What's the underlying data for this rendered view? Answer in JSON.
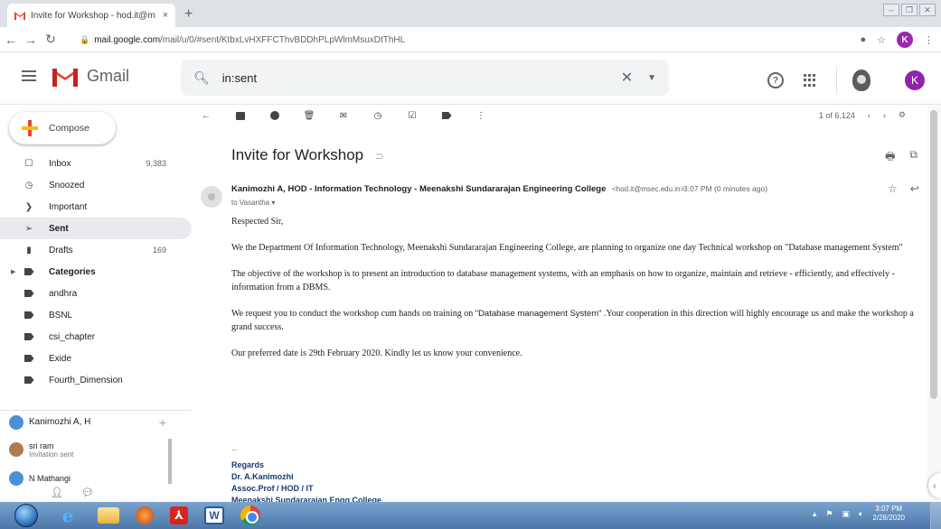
{
  "browser": {
    "tab_title": "Invite for Workshop - hod.it@m",
    "tab_close": "×",
    "new_tab": "+",
    "url_domain": "mail.google.com",
    "url_path": "/mail/u/0/#sent/KtbxLvHXFFCThvBDDhPLpWlmMsuxDtThHL"
  },
  "gmail": {
    "app_name": "Gmail",
    "search_value": "in:sent",
    "profile_initial": "K",
    "help": "?"
  },
  "sidebar": {
    "compose": "Compose",
    "items": [
      {
        "label": "Inbox",
        "count": "9,383"
      },
      {
        "label": "Snoozed",
        "count": ""
      },
      {
        "label": "Important",
        "count": ""
      },
      {
        "label": "Sent",
        "count": ""
      },
      {
        "label": "Drafts",
        "count": "169"
      },
      {
        "label": "Categories",
        "count": ""
      },
      {
        "label": "andhra",
        "count": ""
      },
      {
        "label": "BSNL",
        "count": ""
      },
      {
        "label": "csi_chapter",
        "count": ""
      },
      {
        "label": "Exide",
        "count": ""
      },
      {
        "label": "Fourth_Dimension",
        "count": ""
      }
    ],
    "chat_self": "Kanimozhi A, H",
    "chats": [
      {
        "name": "sri ram",
        "status": "Invitation sent"
      },
      {
        "name": "N Mathangi",
        "status": ""
      }
    ]
  },
  "toolbar": {
    "pager": "1 of 6,124"
  },
  "message": {
    "subject": "Invite for Workshop",
    "sender_name": "Kanimozhi A, HOD - Information Technology - Meenakshi Sundararajan Engineering College",
    "sender_email": "<hod.it@msec.edu.in>",
    "time": "3:07 PM (0 minutes ago)",
    "to": "to Vasantha ▾",
    "salutation": "Respected Sir,",
    "para1": "We the Department Of Information Technology, Meenakshi Sundararajan Engineering College, are planning to organize one day Technical  workshop on \"Database management System\"",
    "para2": "The objective of the workshop  is to present an introduction to database management systems, with an emphasis on how to organize, maintain and retrieve - efficiently, and effectively - information from a DBMS.",
    "para3_a": "We request you to conduct the workshop cum hands on training  on ",
    "para3_b": "\"Database management System\"",
    "para3_c": " .Your cooperation in this direction will highly encourage us and make the workshop a grand success.",
    "para4": "Our preferred date is 29th February 2020. Kindly let us know your convenience.",
    "sig_dash": "--",
    "sig": [
      "Regards",
      "Dr. A.Kanimozhi",
      "Assoc.Prof / HOD / IT",
      "Meenakshi Sundararajan Engg College"
    ]
  },
  "taskbar": {
    "time": "3:07 PM",
    "date": "2/28/2020"
  }
}
